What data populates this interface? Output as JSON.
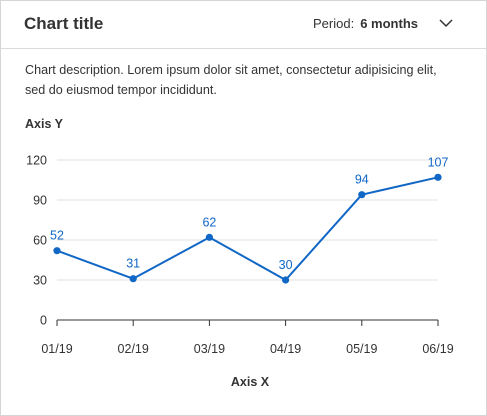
{
  "header": {
    "title": "Chart title",
    "period_label": "Period:",
    "period_value": "6 months",
    "dropdown_icon": "chevron-down-icon"
  },
  "description": "Chart description. Lorem ipsum dolor sit amet, consectetur adipisicing elit, sed do eiusmod tempor incididunt.",
  "colors": {
    "series": "#1167c6",
    "grid": "#e0e0e0",
    "axis": "#333333"
  },
  "chart_data": {
    "type": "line",
    "title": "",
    "xlabel": "Axis X",
    "ylabel": "Axis Y",
    "x": [
      "01/19",
      "02/19",
      "03/19",
      "04/19",
      "05/19",
      "06/19"
    ],
    "series": [
      {
        "values": [
          52,
          31,
          62,
          30,
          94,
          107
        ]
      }
    ],
    "ylim": [
      0,
      120
    ],
    "yticks": [
      0,
      30,
      60,
      90,
      120
    ],
    "grid": true,
    "data_labels": true
  }
}
